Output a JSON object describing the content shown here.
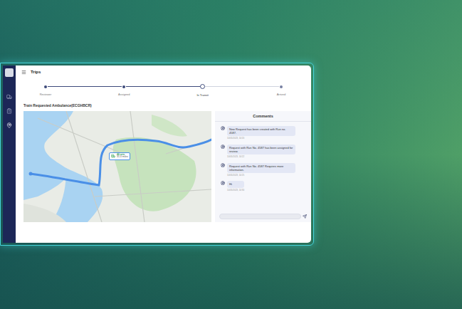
{
  "page": {
    "title": "Trips"
  },
  "stepper": [
    {
      "label": "Reviewer",
      "completed": true,
      "selected": false
    },
    {
      "label": "Assigned",
      "completed": true,
      "selected": false
    },
    {
      "label": "In Transit",
      "completed": false,
      "selected": true
    },
    {
      "label": "Arrived",
      "completed": false,
      "selected": false
    }
  ],
  "trip": {
    "title": "Train Requested Ambulance(ECGHBCR)"
  },
  "map": {
    "eta": "46 min",
    "distance": "31.3 miles"
  },
  "comments": {
    "title": "Comments",
    "messages": [
      {
        "text": "New Request has been created with Run no. 4587.",
        "time": "10/05/2023, 14:20"
      },
      {
        "text": "Request with Run No. 4587 has been assigned for review.",
        "time": "10/05/2023, 14:22"
      },
      {
        "text": "Request with Run No. 4587 Requires more information.",
        "time": "10/05/2023, 14:25"
      },
      {
        "text": "Hi",
        "time": "10/05/2023, 14:30"
      }
    ]
  }
}
